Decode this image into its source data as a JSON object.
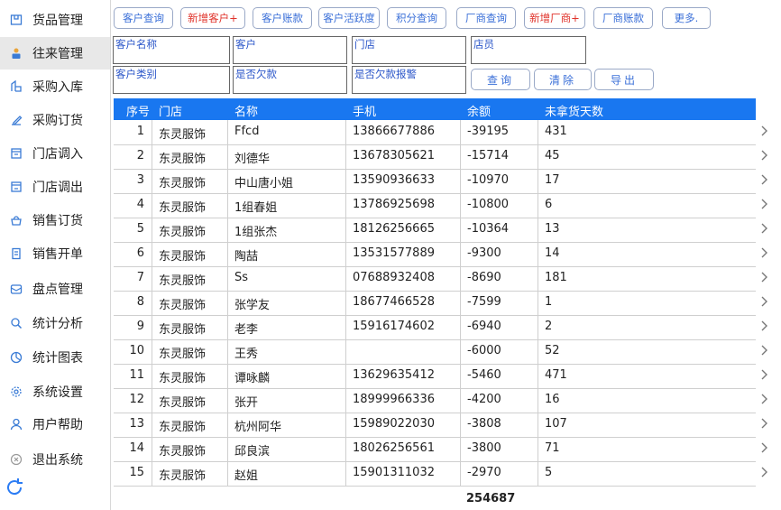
{
  "sidebar": {
    "items": [
      {
        "label": "货品管理",
        "icon": "goods-icon"
      },
      {
        "label": "往来管理",
        "icon": "contacts-icon",
        "active": true
      },
      {
        "label": "采购入库",
        "icon": "purchase-in-icon"
      },
      {
        "label": "采购订货",
        "icon": "purchase-order-icon"
      },
      {
        "label": "门店调入",
        "icon": "store-in-icon"
      },
      {
        "label": "门店调出",
        "icon": "store-out-icon"
      },
      {
        "label": "销售订货",
        "icon": "sales-order-icon"
      },
      {
        "label": "销售开单",
        "icon": "sales-bill-icon"
      },
      {
        "label": "盘点管理",
        "icon": "inventory-icon"
      },
      {
        "label": "统计分析",
        "icon": "analysis-icon"
      },
      {
        "label": "统计图表",
        "icon": "chart-icon"
      },
      {
        "label": "系统设置",
        "icon": "settings-icon"
      },
      {
        "label": "用户帮助",
        "icon": "user-help-icon"
      },
      {
        "label": "退出系统",
        "icon": "exit-icon"
      }
    ]
  },
  "toolbar": {
    "buttons": [
      {
        "label": "客户查询",
        "color": "#3a6fd8"
      },
      {
        "label": "新增客户+",
        "color": "#e0322a"
      },
      {
        "label": "客户账款",
        "color": "#3a6fd8"
      },
      {
        "label": "客户活跃度",
        "color": "#3a6fd8"
      },
      {
        "label": "积分查询",
        "color": "#3a6fd8"
      },
      {
        "label": "厂商查询",
        "color": "#3a6fd8"
      },
      {
        "label": "新增厂商+",
        "color": "#e0322a"
      },
      {
        "label": "厂商账款",
        "color": "#3a6fd8"
      },
      {
        "label": "更多.",
        "color": "#3a6fd8"
      }
    ]
  },
  "filters": {
    "customer_name": {
      "label": "客户名称",
      "value": ""
    },
    "customer": {
      "label": "客户",
      "value": ""
    },
    "store": {
      "label": "门店",
      "value": ""
    },
    "clerk": {
      "label": "店员",
      "value": ""
    },
    "customer_type": {
      "label": "客户类别",
      "value": ""
    },
    "owes": {
      "label": "是否欠款",
      "value": ""
    },
    "owes_alert": {
      "label": "是否欠款报警",
      "value": ""
    },
    "query_label": "查询",
    "clear_label": "清除",
    "export_label": "导出"
  },
  "table": {
    "columns": [
      "序号",
      "门店",
      "名称",
      "手机",
      "余额",
      "未拿货天数"
    ],
    "rows": [
      [
        "1",
        "东灵服饰",
        "Ffcd",
        "13866677886",
        "-39195",
        "431"
      ],
      [
        "2",
        "东灵服饰",
        "刘德华",
        "13678305621",
        "-15714",
        "45"
      ],
      [
        "3",
        "东灵服饰",
        "中山唐小姐",
        "13590936633",
        "-10970",
        "17"
      ],
      [
        "4",
        "东灵服饰",
        "1组春姐",
        "13786925698",
        "-10800",
        "6"
      ],
      [
        "5",
        "东灵服饰",
        "1组张杰",
        "18126256665",
        "-10364",
        "13"
      ],
      [
        "6",
        "东灵服饰",
        "陶喆",
        "13531577889",
        "-9300",
        "14"
      ],
      [
        "7",
        "东灵服饰",
        "Ss",
        "07688932408",
        "-8690",
        "181"
      ],
      [
        "8",
        "东灵服饰",
        "张学友",
        "18677466528",
        "-7599",
        "1"
      ],
      [
        "9",
        "东灵服饰",
        "老李",
        "15916174602",
        "-6940",
        "2"
      ],
      [
        "10",
        "东灵服饰",
        "王秀",
        "",
        "-6000",
        "52"
      ],
      [
        "11",
        "东灵服饰",
        "谭咏麟",
        "13629635412",
        "-5460",
        "471"
      ],
      [
        "12",
        "东灵服饰",
        "张开",
        "18999966336",
        "-4200",
        "16"
      ],
      [
        "13",
        "东灵服饰",
        "杭州阿华",
        "15989022030",
        "-3808",
        "107"
      ],
      [
        "14",
        "东灵服饰",
        "邱良滨",
        "18026256561",
        "-3800",
        "71"
      ],
      [
        "15",
        "东灵服饰",
        "赵姐",
        "15901311032",
        "-2970",
        "5"
      ]
    ],
    "total": "254687"
  },
  "colors": {
    "header_bg": "#1977f0",
    "accent": "#3a6fd8",
    "danger": "#e0322a"
  }
}
